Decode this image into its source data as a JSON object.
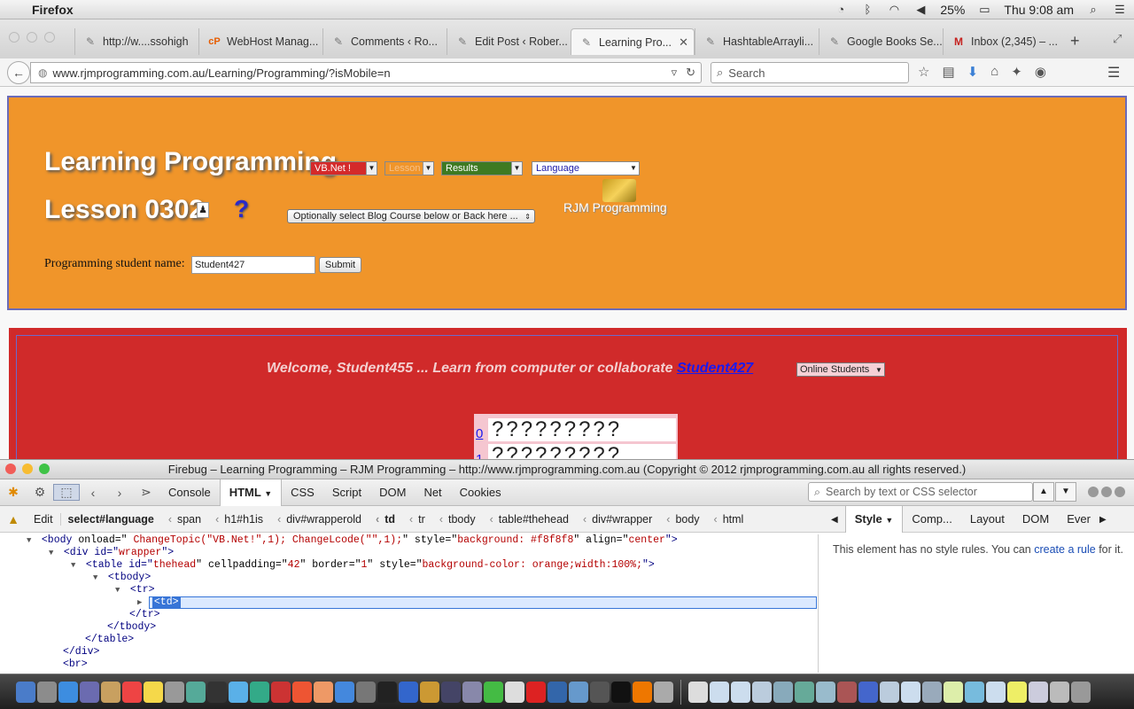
{
  "menubar": {
    "app_name": "Firefox",
    "battery": "25%",
    "clock": "Thu 9:08 am"
  },
  "tabs": [
    {
      "label": "http://w....ssohigh",
      "icon": "page-icon"
    },
    {
      "label": "WebHost Manag...",
      "icon": "cpanel-icon"
    },
    {
      "label": "Comments ‹ Ro...",
      "icon": "page-icon"
    },
    {
      "label": "Edit Post ‹ Rober...",
      "icon": "page-icon"
    },
    {
      "label": "Learning Pro...",
      "icon": "page-icon",
      "active": true
    },
    {
      "label": "HashtableArrayli...",
      "icon": "page-icon"
    },
    {
      "label": "Google Books Se...",
      "icon": "page-icon"
    },
    {
      "label": "Inbox (2,345) – ...",
      "icon": "gmail-icon"
    }
  ],
  "navbar": {
    "url": "www.rjmprogramming.com.au/Learning/Programming/?isMobile=n",
    "search_placeholder": "Search"
  },
  "page": {
    "title_line1": "Learning Programming",
    "title_line2": "Lesson 0302",
    "selects": {
      "topic": "VB.Net !",
      "lesson": "Lesson",
      "results": "Results",
      "language": "Language"
    },
    "blog_select": "Optionally select Blog Course below or Back here ...",
    "logo_text": "RJM Programming",
    "student_label": "Programming student name:",
    "student_value": "Student427",
    "submit_label": "Submit",
    "welcome_text": "Welcome, Student455 ... Learn from computer or collaborate",
    "welcome_link": "Student427",
    "online_select": "Online Students",
    "question_rows": [
      {
        "index": "0",
        "text": "?????????"
      },
      {
        "index": "1",
        "text": "?????????"
      }
    ]
  },
  "firebug": {
    "title": "Firebug – Learning Programming – RJM Programming – http://www.rjmprogramming.com.au (Copyright © 2012 rjmprogramming.com.au all rights reserved.)",
    "tabs": [
      "Console",
      "HTML",
      "CSS",
      "Script",
      "DOM",
      "Net",
      "Cookies"
    ],
    "active_tab": "HTML",
    "search_placeholder": "Search by text or CSS selector",
    "edit_label": "Edit",
    "breadcrumbs": [
      "select#language",
      "span",
      "h1#h1is",
      "div#wrapperold",
      "td",
      "tr",
      "tbody",
      "table#thehead",
      "div#wrapper",
      "body",
      "html"
    ],
    "side_tabs": [
      "Style",
      "Comp...",
      "Layout",
      "DOM",
      "Ever"
    ],
    "side_message": "This element has no style rules. You can",
    "side_link": "create a rule",
    "side_message_end": "for it.",
    "tree": {
      "l1_tag": "<body",
      "l1_attr1": " onload=\"",
      "l1_val1": " ChangeTopic(\"VB.Net!\",1); ChangeLcode(\"\",1);",
      "l1_attr2": "\" style=\"",
      "l1_val2": "background: #f8f8f8",
      "l1_attr3": "\" align=\"",
      "l1_val3": "center",
      "l1_end": "\">",
      "l2_tag": "<div id=\"",
      "l2_val": "wrapper",
      "l2_end": "\">",
      "l3_tag": "<table id=\"",
      "l3_val1": "thehead",
      "l3_attr2": "\" cellpadding=\"",
      "l3_val2": "42",
      "l3_attr3": "\" border=\"",
      "l3_val3": "1",
      "l3_attr4": "\" style=\"",
      "l3_val4": "background-color: orange;width:100%;",
      "l3_end": "\">",
      "l4": "<tbody>",
      "l5": "<tr>",
      "l6": "<td>",
      "l7": "</tr>",
      "l8": "</tbody>",
      "l9": "</table>",
      "l10": "</div>",
      "l11": "<br>"
    }
  }
}
